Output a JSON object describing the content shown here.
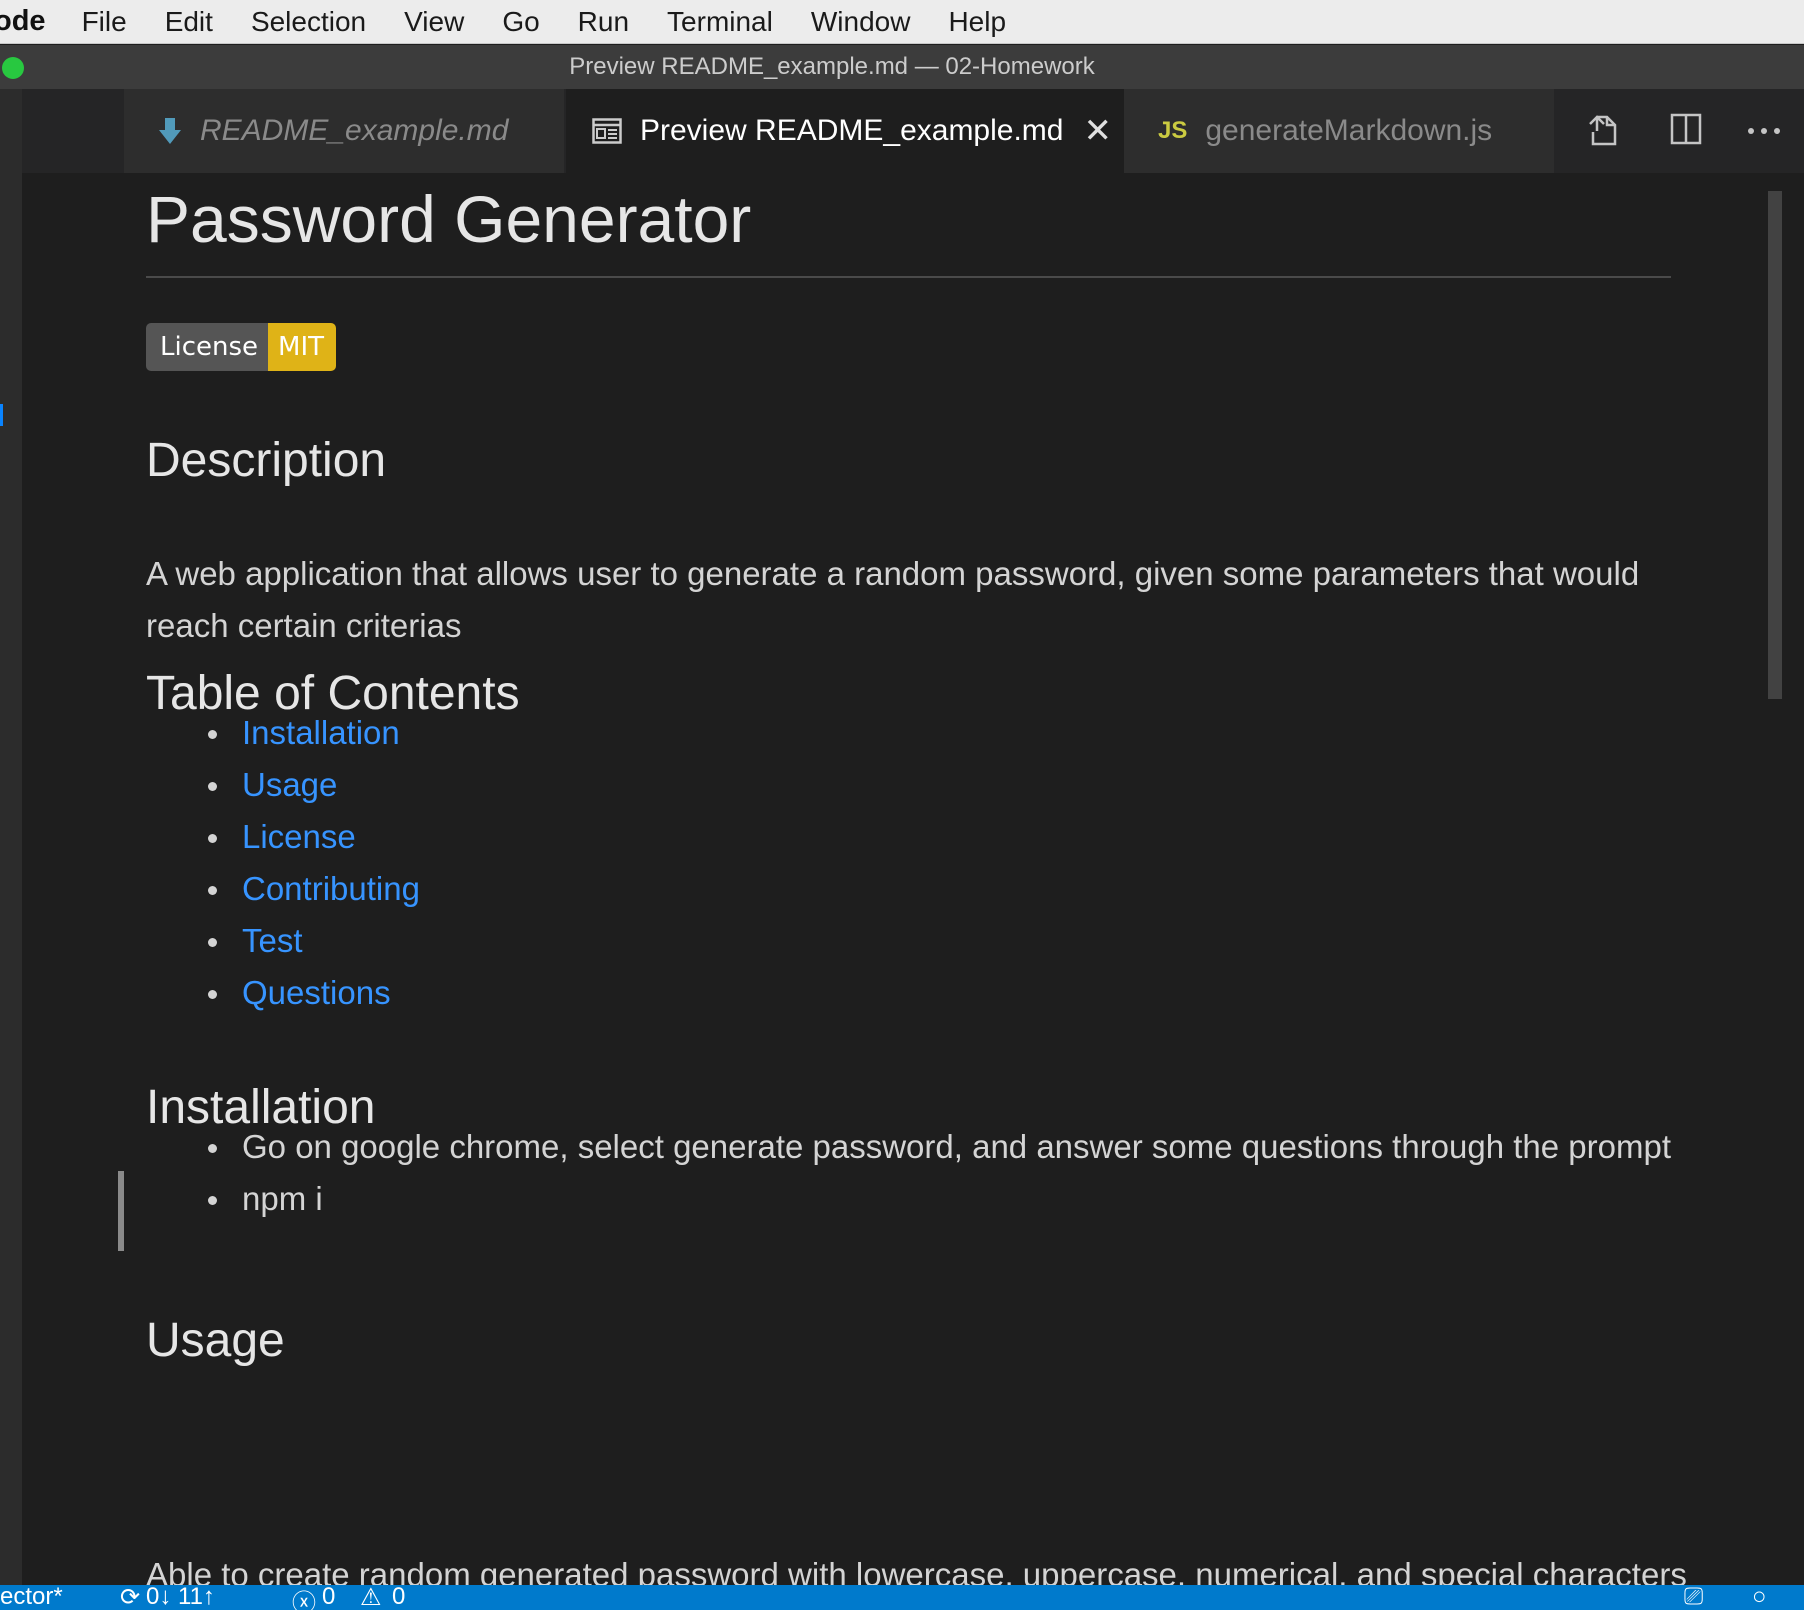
{
  "menubar": {
    "app": "ode",
    "items": [
      "File",
      "Edit",
      "Selection",
      "View",
      "Go",
      "Run",
      "Terminal",
      "Window",
      "Help"
    ]
  },
  "window": {
    "title": "Preview README_example.md — 02-Homework"
  },
  "tabs": [
    {
      "label": "README_example.md",
      "icon": "markdown-icon"
    },
    {
      "label": "Preview README_example.md",
      "icon": "preview-icon",
      "active": true
    },
    {
      "label": "generateMarkdown.js",
      "icon": "js-icon",
      "icon_text": "JS"
    }
  ],
  "doc": {
    "title": "Password Generator",
    "badge": {
      "left": "License",
      "right": "MIT",
      "color": "#dfb317"
    },
    "description_heading": "Description",
    "description": "A web application that allows user to generate a random password, given some parameters that would reach certain criterias",
    "toc_heading": "Table of Contents",
    "toc": [
      "Installation",
      "Usage",
      "License",
      "Contributing",
      "Test",
      "Questions"
    ],
    "installation_heading": "Installation",
    "installation_items": [
      "Go on google chrome, select generate password, and answer some questions through the prompt",
      "npm i"
    ],
    "usage_heading": "Usage",
    "usage_text": "Able to create random generated password with lowercase, uppercase, numerical, and special characters"
  },
  "statusbar": {
    "branch": "ector*",
    "sync": "0↓ 11↑",
    "problems": "0",
    "warnings": "0"
  },
  "colors": {
    "accent": "#007acc",
    "link": "#3794ff"
  }
}
